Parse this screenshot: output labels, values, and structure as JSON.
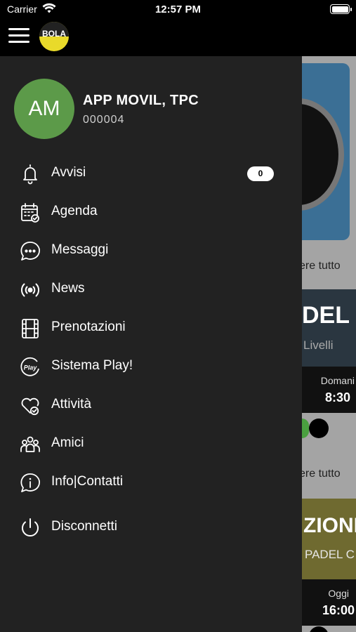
{
  "status_bar": {
    "carrier": "Carrier",
    "time": "12:57 PM"
  },
  "header": {
    "logo_text": "BOLA"
  },
  "user": {
    "initials": "AM",
    "name": "APP MOVIL, TPC",
    "code": "000004"
  },
  "menu": [
    {
      "label": "Avvisi",
      "icon": "bell-icon",
      "badge": "0"
    },
    {
      "label": "Agenda",
      "icon": "calendar-check-icon"
    },
    {
      "label": "Messaggi",
      "icon": "chat-bubble-icon"
    },
    {
      "label": "News",
      "icon": "broadcast-icon"
    },
    {
      "label": "Prenotazioni",
      "icon": "film-strip-icon"
    },
    {
      "label": "Sistema Play!",
      "icon": "play-logo-icon"
    },
    {
      "label": "Attività",
      "icon": "heart-check-icon"
    },
    {
      "label": "Amici",
      "icon": "group-people-icon"
    },
    {
      "label": "Info|Contatti",
      "icon": "info-bubble-icon"
    },
    {
      "label": "Disconnetti",
      "icon": "power-icon"
    }
  ],
  "background": {
    "see_all_1": "ere tutto",
    "banner1_title": "DEL",
    "banner1_sub": "Livelli",
    "card1_day": "Domani",
    "card1_time": "8:30",
    "see_all_2": "ere tutto",
    "banner2_title": "ZIONE",
    "banner2_sub": "PADEL C",
    "card2_day": "Oggi",
    "card2_time": "16:00"
  },
  "colors": {
    "drawer_bg": "#222222",
    "avatar_bg": "#5c9a49",
    "logo_yellow": "#e9da2a"
  }
}
